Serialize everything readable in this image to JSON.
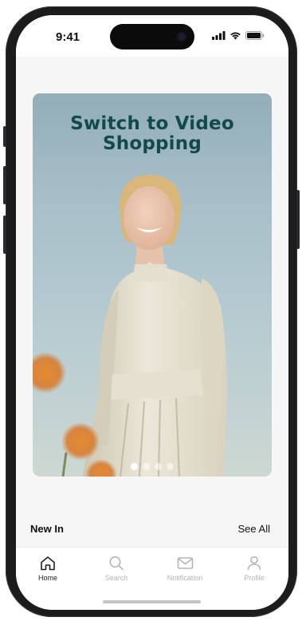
{
  "status_bar": {
    "time": "9:41",
    "icons": [
      "cellular-signal-icon",
      "wifi-icon",
      "battery-icon"
    ]
  },
  "hero": {
    "title_line1": "Switch to Video",
    "title_line2": "Shopping",
    "title_color": "#124a4b",
    "carousel_page_count": 4,
    "carousel_active_index": 0
  },
  "section": {
    "title": "New In",
    "see_all": "See All"
  },
  "tab_bar": {
    "items": [
      {
        "label": "Home",
        "icon": "home-icon",
        "active": true
      },
      {
        "label": "Search",
        "icon": "search-icon",
        "active": false
      },
      {
        "label": "Notification",
        "icon": "mail-icon",
        "active": false
      },
      {
        "label": "Profile",
        "icon": "profile-icon",
        "active": false
      }
    ]
  },
  "colors": {
    "active_tab": "#222222",
    "inactive_tab": "#b4b4ba",
    "screen_background": "#f6f6f7"
  }
}
